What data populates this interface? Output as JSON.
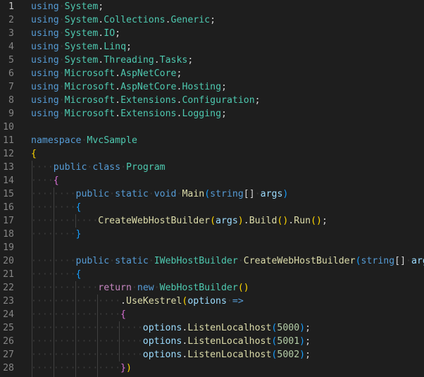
{
  "editor": {
    "language": "csharp",
    "lines": [
      {
        "n": "1",
        "tokens": [
          [
            "kw",
            "using"
          ],
          [
            "ws",
            "·"
          ],
          [
            "ns",
            "System"
          ],
          [
            "pun",
            ";"
          ]
        ]
      },
      {
        "n": "2",
        "tokens": [
          [
            "kw",
            "using"
          ],
          [
            "ws",
            "·"
          ],
          [
            "ns",
            "System"
          ],
          [
            "pun",
            "."
          ],
          [
            "ns",
            "Collections"
          ],
          [
            "pun",
            "."
          ],
          [
            "ns",
            "Generic"
          ],
          [
            "pun",
            ";"
          ]
        ]
      },
      {
        "n": "3",
        "tokens": [
          [
            "kw",
            "using"
          ],
          [
            "ws",
            "·"
          ],
          [
            "ns",
            "System"
          ],
          [
            "pun",
            "."
          ],
          [
            "ns",
            "IO"
          ],
          [
            "pun",
            ";"
          ]
        ]
      },
      {
        "n": "4",
        "tokens": [
          [
            "kw",
            "using"
          ],
          [
            "ws",
            "·"
          ],
          [
            "ns",
            "System"
          ],
          [
            "pun",
            "."
          ],
          [
            "ns",
            "Linq"
          ],
          [
            "pun",
            ";"
          ]
        ]
      },
      {
        "n": "5",
        "tokens": [
          [
            "kw",
            "using"
          ],
          [
            "ws",
            "·"
          ],
          [
            "ns",
            "System"
          ],
          [
            "pun",
            "."
          ],
          [
            "ns",
            "Threading"
          ],
          [
            "pun",
            "."
          ],
          [
            "ns",
            "Tasks"
          ],
          [
            "pun",
            ";"
          ]
        ]
      },
      {
        "n": "6",
        "tokens": [
          [
            "kw",
            "using"
          ],
          [
            "ws",
            "·"
          ],
          [
            "ns",
            "Microsoft"
          ],
          [
            "pun",
            "."
          ],
          [
            "ns",
            "AspNetCore"
          ],
          [
            "pun",
            ";"
          ]
        ]
      },
      {
        "n": "7",
        "tokens": [
          [
            "kw",
            "using"
          ],
          [
            "ws",
            "·"
          ],
          [
            "ns",
            "Microsoft"
          ],
          [
            "pun",
            "."
          ],
          [
            "ns",
            "AspNetCore"
          ],
          [
            "pun",
            "."
          ],
          [
            "ns",
            "Hosting"
          ],
          [
            "pun",
            ";"
          ]
        ]
      },
      {
        "n": "8",
        "tokens": [
          [
            "kw",
            "using"
          ],
          [
            "ws",
            "·"
          ],
          [
            "ns",
            "Microsoft"
          ],
          [
            "pun",
            "."
          ],
          [
            "ns",
            "Extensions"
          ],
          [
            "pun",
            "."
          ],
          [
            "ns",
            "Configuration"
          ],
          [
            "pun",
            ";"
          ]
        ]
      },
      {
        "n": "9",
        "tokens": [
          [
            "kw",
            "using"
          ],
          [
            "ws",
            "·"
          ],
          [
            "ns",
            "Microsoft"
          ],
          [
            "pun",
            "."
          ],
          [
            "ns",
            "Extensions"
          ],
          [
            "pun",
            "."
          ],
          [
            "ns",
            "Logging"
          ],
          [
            "pun",
            ";"
          ]
        ]
      },
      {
        "n": "10",
        "tokens": []
      },
      {
        "n": "11",
        "tokens": [
          [
            "kw",
            "namespace"
          ],
          [
            "ws",
            "·"
          ],
          [
            "ns",
            "MvcSample"
          ]
        ]
      },
      {
        "n": "12",
        "tokens": [
          [
            "b1",
            "{"
          ]
        ]
      },
      {
        "n": "13",
        "tokens": [
          [
            "ws",
            "····"
          ],
          [
            "kw",
            "public"
          ],
          [
            "ws",
            "·"
          ],
          [
            "kw",
            "class"
          ],
          [
            "ws",
            "·"
          ],
          [
            "cls",
            "Program"
          ]
        ]
      },
      {
        "n": "14",
        "tokens": [
          [
            "ws",
            "····"
          ],
          [
            "b2",
            "{"
          ]
        ]
      },
      {
        "n": "15",
        "tokens": [
          [
            "ws",
            "········"
          ],
          [
            "kw",
            "public"
          ],
          [
            "ws",
            "·"
          ],
          [
            "kw",
            "static"
          ],
          [
            "ws",
            "·"
          ],
          [
            "kw",
            "void"
          ],
          [
            "ws",
            "·"
          ],
          [
            "fn",
            "Main"
          ],
          [
            "b3",
            "("
          ],
          [
            "kw",
            "string"
          ],
          [
            "pun",
            "[]"
          ],
          [
            "ws",
            "·"
          ],
          [
            "var",
            "args"
          ],
          [
            "b3",
            ")"
          ]
        ]
      },
      {
        "n": "16",
        "tokens": [
          [
            "ws",
            "········"
          ],
          [
            "b3",
            "{"
          ]
        ]
      },
      {
        "n": "17",
        "tokens": [
          [
            "ws",
            "············"
          ],
          [
            "fn",
            "CreateWebHostBuilder"
          ],
          [
            "b1",
            "("
          ],
          [
            "var",
            "args"
          ],
          [
            "b1",
            ")"
          ],
          [
            "pun",
            "."
          ],
          [
            "fn",
            "Build"
          ],
          [
            "b1",
            "()"
          ],
          [
            "pun",
            "."
          ],
          [
            "fn",
            "Run"
          ],
          [
            "b1",
            "()"
          ],
          [
            "pun",
            ";"
          ]
        ]
      },
      {
        "n": "18",
        "tokens": [
          [
            "ws",
            "········"
          ],
          [
            "b3",
            "}"
          ]
        ]
      },
      {
        "n": "19",
        "tokens": []
      },
      {
        "n": "20",
        "tokens": [
          [
            "ws",
            "········"
          ],
          [
            "kw",
            "public"
          ],
          [
            "ws",
            "·"
          ],
          [
            "kw",
            "static"
          ],
          [
            "ws",
            "·"
          ],
          [
            "cls",
            "IWebHostBuilder"
          ],
          [
            "ws",
            "·"
          ],
          [
            "fn",
            "CreateWebHostBuilder"
          ],
          [
            "b3",
            "("
          ],
          [
            "kw",
            "string"
          ],
          [
            "pun",
            "[]"
          ],
          [
            "ws",
            "·"
          ],
          [
            "var",
            "args"
          ]
        ]
      },
      {
        "n": "21",
        "tokens": [
          [
            "ws",
            "········"
          ],
          [
            "b3",
            "{"
          ]
        ]
      },
      {
        "n": "22",
        "tokens": [
          [
            "ws",
            "············"
          ],
          [
            "kc",
            "return"
          ],
          [
            "ws",
            "·"
          ],
          [
            "kw",
            "new"
          ],
          [
            "ws",
            "·"
          ],
          [
            "cls",
            "WebHostBuilder"
          ],
          [
            "b1",
            "()"
          ]
        ]
      },
      {
        "n": "23",
        "tokens": [
          [
            "ws",
            "················"
          ],
          [
            "pun",
            "."
          ],
          [
            "fn",
            "UseKestrel"
          ],
          [
            "b1",
            "("
          ],
          [
            "var",
            "options"
          ],
          [
            "ws",
            "·"
          ],
          [
            "kw",
            "=>"
          ]
        ]
      },
      {
        "n": "24",
        "tokens": [
          [
            "ws",
            "················"
          ],
          [
            "b2",
            "{"
          ]
        ]
      },
      {
        "n": "25",
        "tokens": [
          [
            "ws",
            "····················"
          ],
          [
            "var",
            "options"
          ],
          [
            "pun",
            "."
          ],
          [
            "fn",
            "ListenLocalhost"
          ],
          [
            "b3",
            "("
          ],
          [
            "num",
            "5000"
          ],
          [
            "b3",
            ")"
          ],
          [
            "pun",
            ";"
          ]
        ]
      },
      {
        "n": "26",
        "tokens": [
          [
            "ws",
            "····················"
          ],
          [
            "var",
            "options"
          ],
          [
            "pun",
            "."
          ],
          [
            "fn",
            "ListenLocalhost"
          ],
          [
            "b3",
            "("
          ],
          [
            "num",
            "5001"
          ],
          [
            "b3",
            ")"
          ],
          [
            "pun",
            ";"
          ]
        ]
      },
      {
        "n": "27",
        "tokens": [
          [
            "ws",
            "····················"
          ],
          [
            "var",
            "options"
          ],
          [
            "pun",
            "."
          ],
          [
            "fn",
            "ListenLocalhost"
          ],
          [
            "b3",
            "("
          ],
          [
            "num",
            "5002"
          ],
          [
            "b3",
            ")"
          ],
          [
            "pun",
            ";"
          ]
        ]
      },
      {
        "n": "28",
        "tokens": [
          [
            "ws",
            "················"
          ],
          [
            "b2",
            "}"
          ],
          [
            "b1",
            ")"
          ]
        ]
      }
    ]
  }
}
